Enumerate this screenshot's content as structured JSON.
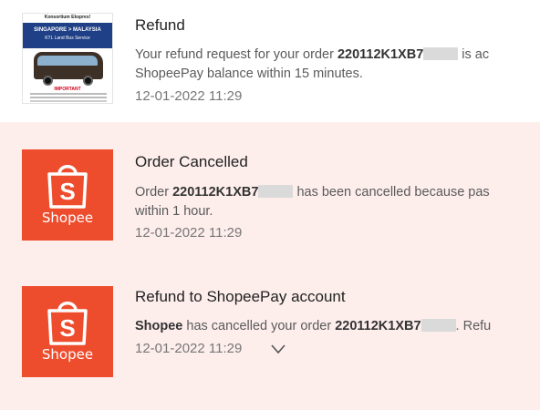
{
  "notifications": [
    {
      "title": "Refund",
      "msg_line1_prefix": "Your refund request for your order ",
      "order_id": "220112K1XB7",
      "msg_line1_suffix": " is ac",
      "msg_line2": "ShopeePay balance within 15 minutes.",
      "time": "12-01-2022 11:29",
      "thumb": {
        "top_text": "Konsortium Ekspres!",
        "band_line1": "SINGAPORE > MALAYSIA",
        "band_line2": "KTL Land Bus Service",
        "red_text": "IMPORTANT"
      }
    },
    {
      "title": "Order Cancelled",
      "msg_line1_prefix": "Order ",
      "order_id": "220112K1XB7",
      "msg_line1_suffix": " has been cancelled because pas",
      "msg_line2": "within 1 hour.",
      "time": "12-01-2022 11:29",
      "logo_text": "Shopee"
    },
    {
      "title": "Refund to ShopeePay account",
      "msg_sender": "Shopee",
      "msg_middle": " has cancelled your order ",
      "order_id": "220112K1XB7",
      "msg_suffix": ". Refu",
      "time": "12-01-2022 11:29",
      "logo_text": "Shopee",
      "expand_icon": "chevron-down-icon"
    }
  ],
  "colors": {
    "shopee_orange": "#ee4d2d",
    "unread_bg": "#fdeeec"
  }
}
